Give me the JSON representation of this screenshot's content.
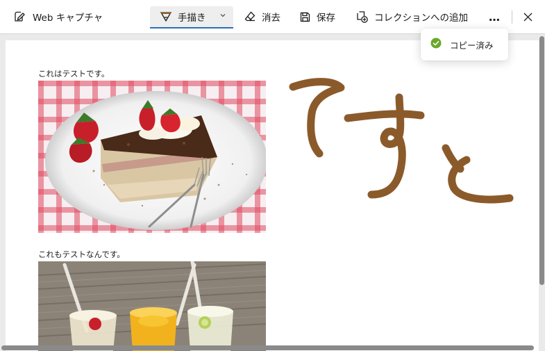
{
  "toolbar": {
    "title": "Web キャプチャ",
    "pen_label": "手描き",
    "erase_label": "消去",
    "save_label": "保存",
    "collection_label": "コレクションへの追加",
    "more_label": "…"
  },
  "toast": {
    "message": "コピー済み"
  },
  "content": {
    "caption1": "これはテストです。",
    "caption2": "これもテストなんです。"
  },
  "colors": {
    "ink": "#8b5a2b",
    "accent": "#2b6fb5",
    "success": "#6aa82c"
  }
}
